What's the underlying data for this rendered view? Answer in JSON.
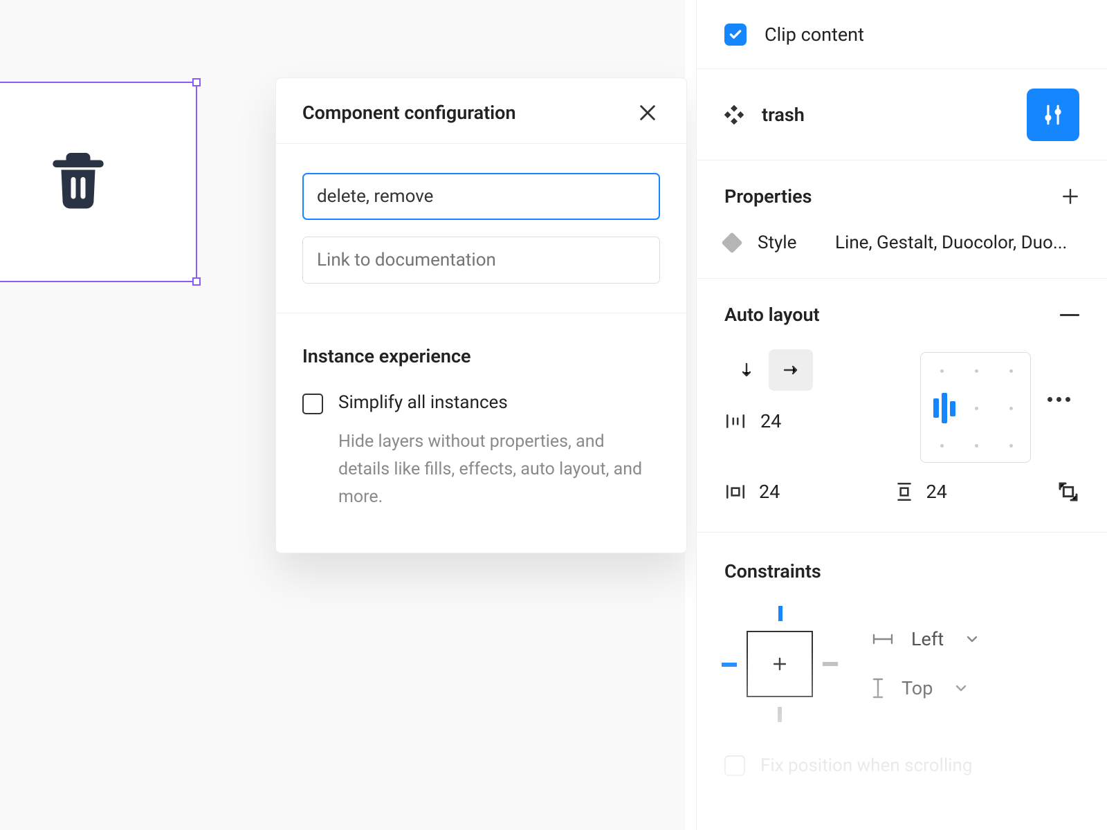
{
  "canvas": {
    "selected_component_icon": "trash"
  },
  "modal": {
    "title": "Component configuration",
    "description_value": "delete, remove",
    "doc_link_placeholder": "Link to documentation",
    "instance_section_title": "Instance experience",
    "simplify_label": "Simplify all instances",
    "simplify_desc": "Hide layers without properties, and details like fills, effects, auto layout, and more.",
    "simplify_checked": false
  },
  "inspector": {
    "clip_content": {
      "label": "Clip content",
      "checked": true
    },
    "component": {
      "name": "trash"
    },
    "properties": {
      "title": "Properties",
      "rows": [
        {
          "name": "Style",
          "values": "Line, Gestalt, Duocolor, Duo..."
        }
      ]
    },
    "auto_layout": {
      "title": "Auto layout",
      "direction": "horizontal",
      "item_spacing": "24",
      "padding_horizontal": "24",
      "padding_vertical": "24",
      "alignment": "left-center"
    },
    "constraints": {
      "title": "Constraints",
      "horizontal": "Left",
      "vertical": "Top",
      "fix_label": "Fix position when scrolling",
      "fix_checked": false
    }
  }
}
